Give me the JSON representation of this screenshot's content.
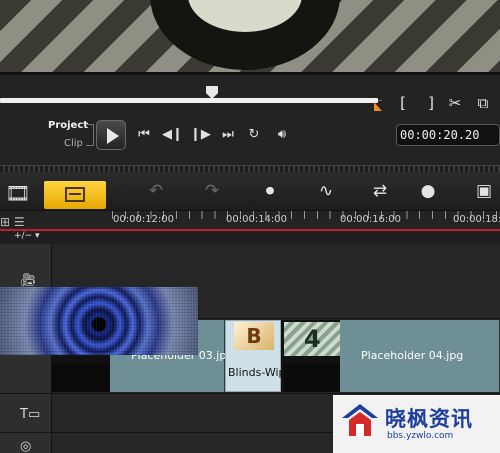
{
  "player": {
    "mode_project": "Project",
    "mode_clip": "Clip",
    "progress_fraction": 0.756,
    "playhead_fraction": 0.424,
    "mark_in": "[",
    "mark_out": "]",
    "timecode": "00:00:20.20"
  },
  "ruler": {
    "labels": [
      "00:00:12:00",
      "00:00:14:00",
      "00:00:16:00",
      "00:00:18:0"
    ]
  },
  "tracks": {
    "add_remove": "+/−"
  },
  "clips": {
    "placeholder_03": "Placeholder 03.jp",
    "blinds_wipe": "Blinds-Wip",
    "placeholder_04": "Placeholder 04.jpg",
    "transition_letter": "B",
    "wipe_number": "4"
  },
  "watermark": {
    "title": "晓枫资讯",
    "url": "bbs.yzwlo.com"
  },
  "colors": {
    "accent_orange": "#f08a1c",
    "timeline_yellow": "#f5c21a",
    "ruler_red": "#b8222a",
    "clip_teal": "#6f8f96"
  }
}
